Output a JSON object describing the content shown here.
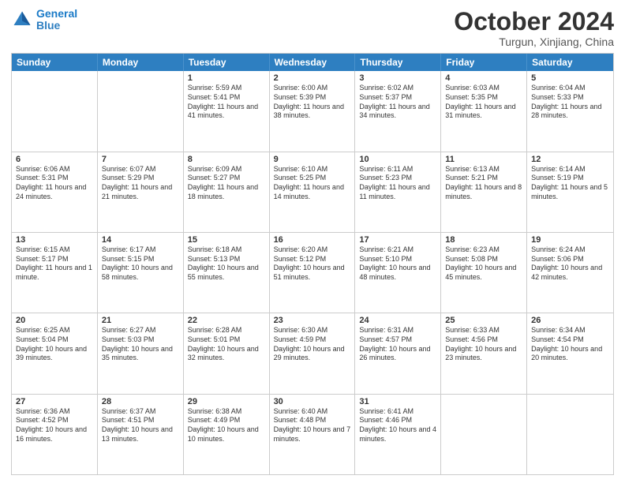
{
  "logo": {
    "line1": "General",
    "line2": "Blue"
  },
  "title": "October 2024",
  "location": "Turgun, Xinjiang, China",
  "header_days": [
    "Sunday",
    "Monday",
    "Tuesday",
    "Wednesday",
    "Thursday",
    "Friday",
    "Saturday"
  ],
  "weeks": [
    [
      {
        "day": "",
        "sunrise": "",
        "sunset": "",
        "daylight": ""
      },
      {
        "day": "",
        "sunrise": "",
        "sunset": "",
        "daylight": ""
      },
      {
        "day": "1",
        "sunrise": "Sunrise: 5:59 AM",
        "sunset": "Sunset: 5:41 PM",
        "daylight": "Daylight: 11 hours and 41 minutes."
      },
      {
        "day": "2",
        "sunrise": "Sunrise: 6:00 AM",
        "sunset": "Sunset: 5:39 PM",
        "daylight": "Daylight: 11 hours and 38 minutes."
      },
      {
        "day": "3",
        "sunrise": "Sunrise: 6:02 AM",
        "sunset": "Sunset: 5:37 PM",
        "daylight": "Daylight: 11 hours and 34 minutes."
      },
      {
        "day": "4",
        "sunrise": "Sunrise: 6:03 AM",
        "sunset": "Sunset: 5:35 PM",
        "daylight": "Daylight: 11 hours and 31 minutes."
      },
      {
        "day": "5",
        "sunrise": "Sunrise: 6:04 AM",
        "sunset": "Sunset: 5:33 PM",
        "daylight": "Daylight: 11 hours and 28 minutes."
      }
    ],
    [
      {
        "day": "6",
        "sunrise": "Sunrise: 6:06 AM",
        "sunset": "Sunset: 5:31 PM",
        "daylight": "Daylight: 11 hours and 24 minutes."
      },
      {
        "day": "7",
        "sunrise": "Sunrise: 6:07 AM",
        "sunset": "Sunset: 5:29 PM",
        "daylight": "Daylight: 11 hours and 21 minutes."
      },
      {
        "day": "8",
        "sunrise": "Sunrise: 6:09 AM",
        "sunset": "Sunset: 5:27 PM",
        "daylight": "Daylight: 11 hours and 18 minutes."
      },
      {
        "day": "9",
        "sunrise": "Sunrise: 6:10 AM",
        "sunset": "Sunset: 5:25 PM",
        "daylight": "Daylight: 11 hours and 14 minutes."
      },
      {
        "day": "10",
        "sunrise": "Sunrise: 6:11 AM",
        "sunset": "Sunset: 5:23 PM",
        "daylight": "Daylight: 11 hours and 11 minutes."
      },
      {
        "day": "11",
        "sunrise": "Sunrise: 6:13 AM",
        "sunset": "Sunset: 5:21 PM",
        "daylight": "Daylight: 11 hours and 8 minutes."
      },
      {
        "day": "12",
        "sunrise": "Sunrise: 6:14 AM",
        "sunset": "Sunset: 5:19 PM",
        "daylight": "Daylight: 11 hours and 5 minutes."
      }
    ],
    [
      {
        "day": "13",
        "sunrise": "Sunrise: 6:15 AM",
        "sunset": "Sunset: 5:17 PM",
        "daylight": "Daylight: 11 hours and 1 minute."
      },
      {
        "day": "14",
        "sunrise": "Sunrise: 6:17 AM",
        "sunset": "Sunset: 5:15 PM",
        "daylight": "Daylight: 10 hours and 58 minutes."
      },
      {
        "day": "15",
        "sunrise": "Sunrise: 6:18 AM",
        "sunset": "Sunset: 5:13 PM",
        "daylight": "Daylight: 10 hours and 55 minutes."
      },
      {
        "day": "16",
        "sunrise": "Sunrise: 6:20 AM",
        "sunset": "Sunset: 5:12 PM",
        "daylight": "Daylight: 10 hours and 51 minutes."
      },
      {
        "day": "17",
        "sunrise": "Sunrise: 6:21 AM",
        "sunset": "Sunset: 5:10 PM",
        "daylight": "Daylight: 10 hours and 48 minutes."
      },
      {
        "day": "18",
        "sunrise": "Sunrise: 6:23 AM",
        "sunset": "Sunset: 5:08 PM",
        "daylight": "Daylight: 10 hours and 45 minutes."
      },
      {
        "day": "19",
        "sunrise": "Sunrise: 6:24 AM",
        "sunset": "Sunset: 5:06 PM",
        "daylight": "Daylight: 10 hours and 42 minutes."
      }
    ],
    [
      {
        "day": "20",
        "sunrise": "Sunrise: 6:25 AM",
        "sunset": "Sunset: 5:04 PM",
        "daylight": "Daylight: 10 hours and 39 minutes."
      },
      {
        "day": "21",
        "sunrise": "Sunrise: 6:27 AM",
        "sunset": "Sunset: 5:03 PM",
        "daylight": "Daylight: 10 hours and 35 minutes."
      },
      {
        "day": "22",
        "sunrise": "Sunrise: 6:28 AM",
        "sunset": "Sunset: 5:01 PM",
        "daylight": "Daylight: 10 hours and 32 minutes."
      },
      {
        "day": "23",
        "sunrise": "Sunrise: 6:30 AM",
        "sunset": "Sunset: 4:59 PM",
        "daylight": "Daylight: 10 hours and 29 minutes."
      },
      {
        "day": "24",
        "sunrise": "Sunrise: 6:31 AM",
        "sunset": "Sunset: 4:57 PM",
        "daylight": "Daylight: 10 hours and 26 minutes."
      },
      {
        "day": "25",
        "sunrise": "Sunrise: 6:33 AM",
        "sunset": "Sunset: 4:56 PM",
        "daylight": "Daylight: 10 hours and 23 minutes."
      },
      {
        "day": "26",
        "sunrise": "Sunrise: 6:34 AM",
        "sunset": "Sunset: 4:54 PM",
        "daylight": "Daylight: 10 hours and 20 minutes."
      }
    ],
    [
      {
        "day": "27",
        "sunrise": "Sunrise: 6:36 AM",
        "sunset": "Sunset: 4:52 PM",
        "daylight": "Daylight: 10 hours and 16 minutes."
      },
      {
        "day": "28",
        "sunrise": "Sunrise: 6:37 AM",
        "sunset": "Sunset: 4:51 PM",
        "daylight": "Daylight: 10 hours and 13 minutes."
      },
      {
        "day": "29",
        "sunrise": "Sunrise: 6:38 AM",
        "sunset": "Sunset: 4:49 PM",
        "daylight": "Daylight: 10 hours and 10 minutes."
      },
      {
        "day": "30",
        "sunrise": "Sunrise: 6:40 AM",
        "sunset": "Sunset: 4:48 PM",
        "daylight": "Daylight: 10 hours and 7 minutes."
      },
      {
        "day": "31",
        "sunrise": "Sunrise: 6:41 AM",
        "sunset": "Sunset: 4:46 PM",
        "daylight": "Daylight: 10 hours and 4 minutes."
      },
      {
        "day": "",
        "sunrise": "",
        "sunset": "",
        "daylight": ""
      },
      {
        "day": "",
        "sunrise": "",
        "sunset": "",
        "daylight": ""
      }
    ]
  ]
}
